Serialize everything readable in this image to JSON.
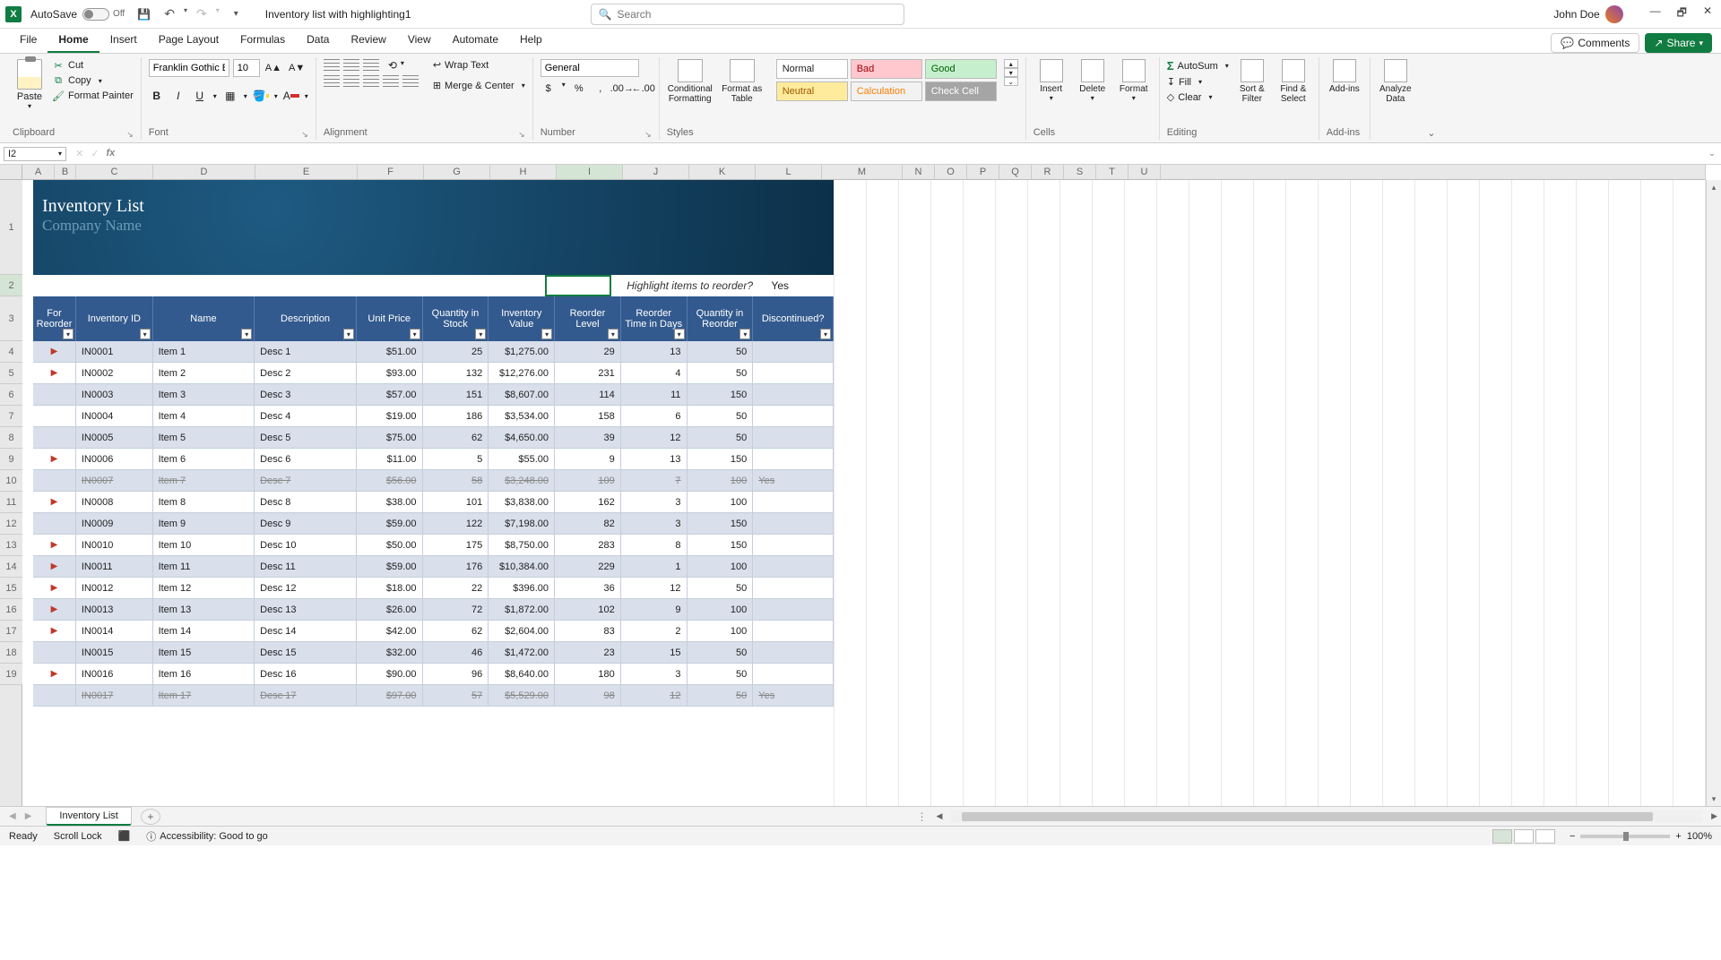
{
  "titlebar": {
    "autosave_label": "AutoSave",
    "autosave_state": "Off",
    "doc_name": "Inventory list with highlighting1",
    "search_placeholder": "Search",
    "user_name": "John Doe"
  },
  "tabs": {
    "items": [
      "File",
      "Home",
      "Insert",
      "Page Layout",
      "Formulas",
      "Data",
      "Review",
      "View",
      "Automate",
      "Help"
    ],
    "active": "Home",
    "comments_label": "Comments",
    "share_label": "Share"
  },
  "ribbon": {
    "clipboard": {
      "paste": "Paste",
      "cut": "Cut",
      "copy": "Copy",
      "format_painter": "Format Painter",
      "label": "Clipboard"
    },
    "font": {
      "name": "Franklin Gothic Boo",
      "size": "10",
      "inc": "A",
      "dec": "A",
      "b": "B",
      "i": "I",
      "u": "U",
      "label": "Font"
    },
    "alignment": {
      "wrap": "Wrap Text",
      "merge": "Merge & Center",
      "label": "Alignment"
    },
    "number": {
      "format": "General",
      "label": "Number"
    },
    "styles": {
      "cond": "Conditional\nFormatting",
      "fat": "Format as\nTable",
      "label": "Styles",
      "cells": {
        "normal": "Normal",
        "bad": "Bad",
        "good": "Good",
        "neutral": "Neutral",
        "calc": "Calculation",
        "check": "Check Cell"
      }
    },
    "cells_group": {
      "insert": "Insert",
      "delete": "Delete",
      "format": "Format",
      "label": "Cells"
    },
    "editing": {
      "autosum": "AutoSum",
      "fill": "Fill",
      "clear": "Clear",
      "sort": "Sort &\nFilter",
      "find": "Find &\nSelect",
      "label": "Editing"
    },
    "addins": {
      "btn": "Add-ins",
      "label": "Add-ins"
    },
    "analyze": {
      "btn": "Analyze\nData"
    }
  },
  "namebox": "I2",
  "sheet": {
    "banner_title": "Inventory List",
    "banner_company": "Company Name",
    "highlight_label": "Highlight items to reorder?",
    "highlight_value": "Yes",
    "columns": [
      "A",
      "B",
      "C",
      "D",
      "E",
      "F",
      "G",
      "H",
      "I",
      "J",
      "K",
      "L",
      "M",
      "N",
      "O",
      "P",
      "Q",
      "R",
      "S",
      "T",
      "U"
    ],
    "row_nums": [
      1,
      2,
      3,
      4,
      5,
      6,
      7,
      8,
      9,
      10,
      11,
      12,
      13,
      14,
      15,
      16,
      17,
      18,
      19
    ],
    "th": [
      "For Reorder",
      "Inventory ID",
      "Name",
      "Description",
      "Unit Price",
      "Quantity in Stock",
      "Inventory Value",
      "Reorder Level",
      "Reorder Time in Days",
      "Quantity in Reorder",
      "Discontinued?"
    ],
    "rows": [
      {
        "flag": true,
        "id": "IN0001",
        "name": "Item 1",
        "desc": "Desc 1",
        "price": "$51.00",
        "qty": "25",
        "val": "$1,275.00",
        "rl": "29",
        "rt": "13",
        "qr": "50",
        "disc": ""
      },
      {
        "flag": true,
        "id": "IN0002",
        "name": "Item 2",
        "desc": "Desc 2",
        "price": "$93.00",
        "qty": "132",
        "val": "$12,276.00",
        "rl": "231",
        "rt": "4",
        "qr": "50",
        "disc": ""
      },
      {
        "flag": false,
        "id": "IN0003",
        "name": "Item 3",
        "desc": "Desc 3",
        "price": "$57.00",
        "qty": "151",
        "val": "$8,607.00",
        "rl": "114",
        "rt": "11",
        "qr": "150",
        "disc": ""
      },
      {
        "flag": false,
        "id": "IN0004",
        "name": "Item 4",
        "desc": "Desc 4",
        "price": "$19.00",
        "qty": "186",
        "val": "$3,534.00",
        "rl": "158",
        "rt": "6",
        "qr": "50",
        "disc": ""
      },
      {
        "flag": false,
        "id": "IN0005",
        "name": "Item 5",
        "desc": "Desc 5",
        "price": "$75.00",
        "qty": "62",
        "val": "$4,650.00",
        "rl": "39",
        "rt": "12",
        "qr": "50",
        "disc": ""
      },
      {
        "flag": true,
        "id": "IN0006",
        "name": "Item 6",
        "desc": "Desc 6",
        "price": "$11.00",
        "qty": "5",
        "val": "$55.00",
        "rl": "9",
        "rt": "13",
        "qr": "150",
        "disc": ""
      },
      {
        "flag": false,
        "id": "IN0007",
        "name": "Item 7",
        "desc": "Desc 7",
        "price": "$56.00",
        "qty": "58",
        "val": "$3,248.00",
        "rl": "109",
        "rt": "7",
        "qr": "100",
        "disc": "Yes",
        "discontinued": true
      },
      {
        "flag": true,
        "id": "IN0008",
        "name": "Item 8",
        "desc": "Desc 8",
        "price": "$38.00",
        "qty": "101",
        "val": "$3,838.00",
        "rl": "162",
        "rt": "3",
        "qr": "100",
        "disc": ""
      },
      {
        "flag": false,
        "id": "IN0009",
        "name": "Item 9",
        "desc": "Desc 9",
        "price": "$59.00",
        "qty": "122",
        "val": "$7,198.00",
        "rl": "82",
        "rt": "3",
        "qr": "150",
        "disc": ""
      },
      {
        "flag": true,
        "id": "IN0010",
        "name": "Item 10",
        "desc": "Desc 10",
        "price": "$50.00",
        "qty": "175",
        "val": "$8,750.00",
        "rl": "283",
        "rt": "8",
        "qr": "150",
        "disc": ""
      },
      {
        "flag": true,
        "id": "IN0011",
        "name": "Item 11",
        "desc": "Desc 11",
        "price": "$59.00",
        "qty": "176",
        "val": "$10,384.00",
        "rl": "229",
        "rt": "1",
        "qr": "100",
        "disc": ""
      },
      {
        "flag": true,
        "id": "IN0012",
        "name": "Item 12",
        "desc": "Desc 12",
        "price": "$18.00",
        "qty": "22",
        "val": "$396.00",
        "rl": "36",
        "rt": "12",
        "qr": "50",
        "disc": ""
      },
      {
        "flag": true,
        "id": "IN0013",
        "name": "Item 13",
        "desc": "Desc 13",
        "price": "$26.00",
        "qty": "72",
        "val": "$1,872.00",
        "rl": "102",
        "rt": "9",
        "qr": "100",
        "disc": ""
      },
      {
        "flag": true,
        "id": "IN0014",
        "name": "Item 14",
        "desc": "Desc 14",
        "price": "$42.00",
        "qty": "62",
        "val": "$2,604.00",
        "rl": "83",
        "rt": "2",
        "qr": "100",
        "disc": ""
      },
      {
        "flag": false,
        "id": "IN0015",
        "name": "Item 15",
        "desc": "Desc 15",
        "price": "$32.00",
        "qty": "46",
        "val": "$1,472.00",
        "rl": "23",
        "rt": "15",
        "qr": "50",
        "disc": ""
      },
      {
        "flag": true,
        "id": "IN0016",
        "name": "Item 16",
        "desc": "Desc 16",
        "price": "$90.00",
        "qty": "96",
        "val": "$8,640.00",
        "rl": "180",
        "rt": "3",
        "qr": "50",
        "disc": ""
      },
      {
        "flag": false,
        "id": "IN0017",
        "name": "Item 17",
        "desc": "Desc 17",
        "price": "$97.00",
        "qty": "57",
        "val": "$5,529.00",
        "rl": "98",
        "rt": "12",
        "qr": "50",
        "disc": "Yes",
        "discontinued": true
      }
    ]
  },
  "sheet_tab": "Inventory List",
  "status": {
    "ready": "Ready",
    "scroll": "Scroll Lock",
    "acc": "Accessibility: Good to go",
    "zoom": "100%"
  }
}
